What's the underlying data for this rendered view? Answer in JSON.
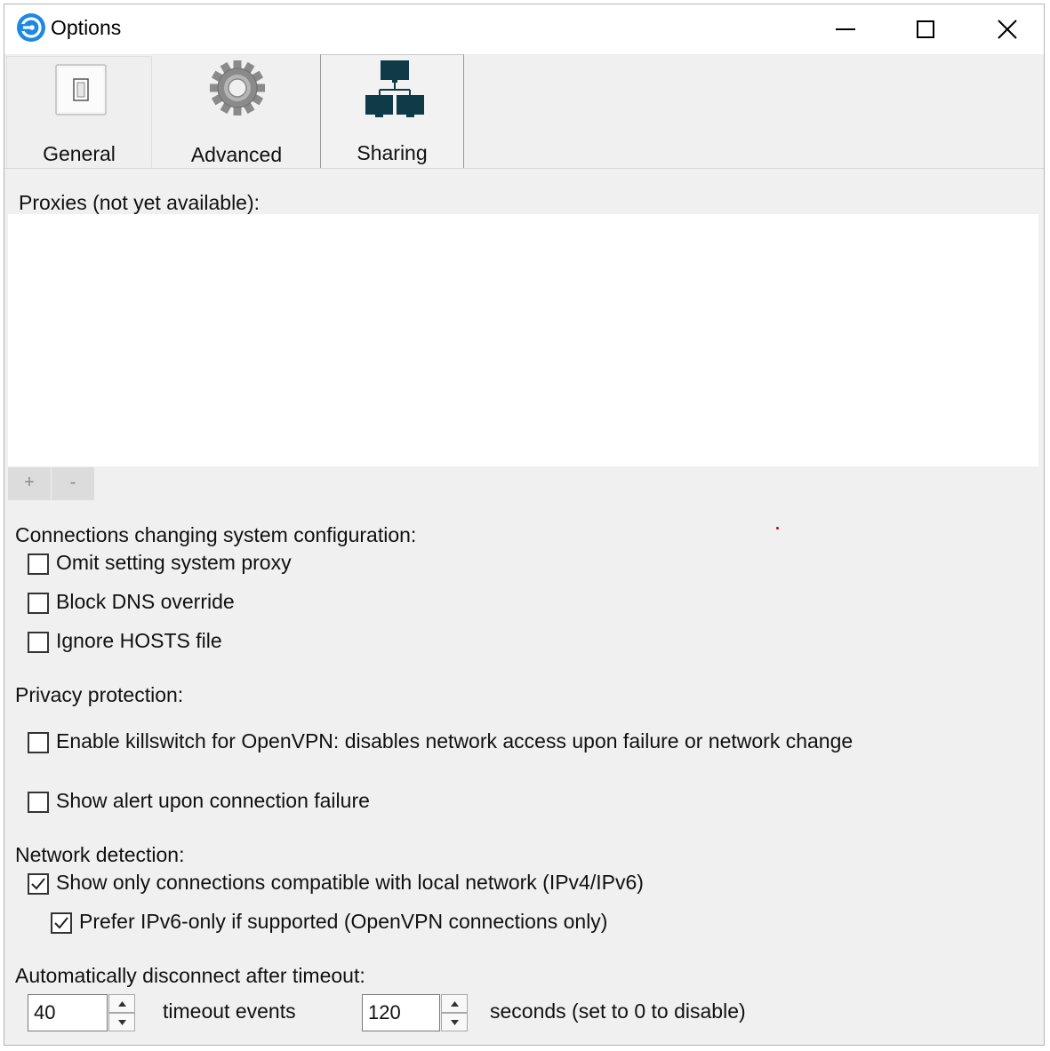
{
  "window": {
    "title": "Options"
  },
  "tabs": {
    "general": {
      "label": "General",
      "icon": "switch-icon"
    },
    "advanced": {
      "label": "Advanced",
      "icon": "gear-icon"
    },
    "sharing": {
      "label": "Sharing",
      "icon": "network-icon"
    }
  },
  "proxies": {
    "label": "Proxies (not yet available):",
    "add_label": "+",
    "remove_label": "-"
  },
  "system_config": {
    "label": "Connections changing system configuration:",
    "options": [
      {
        "label": "Omit setting system proxy",
        "checked": false
      },
      {
        "label": "Block DNS override",
        "checked": false
      },
      {
        "label": "Ignore HOSTS file",
        "checked": false
      }
    ]
  },
  "privacy": {
    "label": "Privacy protection:",
    "options": [
      {
        "label": "Enable killswitch for OpenVPN: disables network access upon failure or network change",
        "checked": false
      },
      {
        "label": "Show alert upon connection failure",
        "checked": false
      }
    ]
  },
  "network_detection": {
    "label": "Network detection:",
    "options": [
      {
        "label": "Show only connections compatible with local network (IPv4/IPv6)",
        "checked": true
      },
      {
        "label": "Prefer IPv6-only if supported (OpenVPN connections only)",
        "checked": true
      }
    ]
  },
  "timeout": {
    "label": "Automatically disconnect after timeout:",
    "events_value": "40",
    "events_label": "timeout events",
    "seconds_value": "120",
    "seconds_label": "seconds (set to 0 to disable)"
  },
  "colors": {
    "app_icon": "#1e88e5",
    "window_bg": "#f0f0f0",
    "list_bg": "#ffffff",
    "network_icon": "#0f3a48"
  }
}
